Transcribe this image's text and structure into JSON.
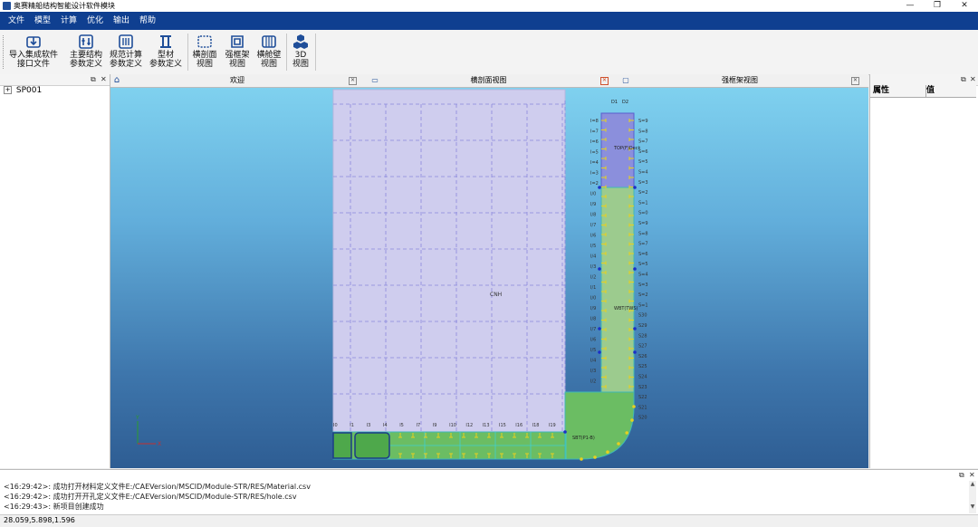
{
  "window": {
    "title": "奥赛精船结构智能设计软件模块",
    "minimize": "—",
    "maximize": "❐",
    "close": "✕"
  },
  "menu": [
    "文件",
    "模型",
    "计算",
    "优化",
    "输出",
    "帮助"
  ],
  "toolbar": {
    "import_line1": "导入集成软件",
    "import_line2": "接口文件",
    "main_line1": "主要结构",
    "main_line2": "参数定义",
    "rule_line1": "规范计算",
    "rule_line2": "参数定义",
    "profile_line1": "型材",
    "profile_line2": "参数定义",
    "cross_line1": "横剖面",
    "cross_line2": "视图",
    "frame_line1": "强框架",
    "frame_line2": "视图",
    "bulk_line1": "横舱壁",
    "bulk_line2": "视图",
    "view3d_line1": "3D",
    "view3d_line2": "视图"
  },
  "tree": {
    "root": "SP001",
    "expander": "+"
  },
  "tabs": {
    "welcome": "欢迎",
    "cross_section": "横剖面视图",
    "frame": "强框架视图"
  },
  "properties": {
    "col_attr": "属性",
    "col_value": "值"
  },
  "drawing": {
    "top_labels": [
      "D1",
      "D2"
    ],
    "center_label": "CNH",
    "upper_wing_label": "TOP(F)Deck",
    "mid_wing_label": "WBT(TWS)",
    "bilge_label": "SBT(P1-B)",
    "inner_left_labels": [
      "I=8",
      "I=7",
      "I=6",
      "I=5",
      "I=4",
      "I=3",
      "I=2",
      "I/0",
      "I/9",
      "I/8",
      "I/7",
      "I/6",
      "I/5",
      "I/4",
      "I/3",
      "I/2",
      "I/1",
      "I/0",
      "I/9",
      "I/8",
      "I/7",
      "I/6",
      "I/5",
      "I/4",
      "I/3",
      "I/2"
    ],
    "shell_labels": [
      "S=9",
      "S=8",
      "S=7",
      "S=6",
      "S=5",
      "S=4",
      "S=3",
      "S=2",
      "S=1",
      "S=0",
      "S=9",
      "S=8",
      "S=7",
      "S=6",
      "S=5",
      "S=4",
      "S=3",
      "S=2",
      "S=1",
      "S30",
      "S29",
      "S28",
      "S27",
      "S26",
      "S25",
      "S24",
      "S23",
      "S22",
      "S21",
      "S20"
    ],
    "bottom_labels": [
      "I0",
      "I1",
      "I3",
      "I4",
      "I5",
      "I7",
      "I9",
      "I10",
      "I12",
      "I13",
      "I15",
      "I16",
      "I18",
      "I19"
    ],
    "axis_y": "Y",
    "axis_x": "X"
  },
  "output": {
    "lines": [
      "<16:29:42>: 成功打开材料定义文件E:/CAEVersion/MSCID/Module-STR/RES/Material.csv",
      "<16:29:42>: 成功打开开孔定义文件E:/CAEVersion/MSCID/Module-STR/RES/hole.csv",
      "<16:29:43>: 新项目创建成功"
    ]
  },
  "status": {
    "coords": "28.059,5.898,1.596"
  },
  "colors": {
    "menubar": "#0f3f90",
    "viewport_top": "#7fd1ef",
    "viewport_bottom": "#2e5d93",
    "hold": "#cfcdee",
    "wing_upper": "#8b8fdc",
    "wing_green": "#9ccb8e",
    "bottom": "#6bbd63"
  }
}
